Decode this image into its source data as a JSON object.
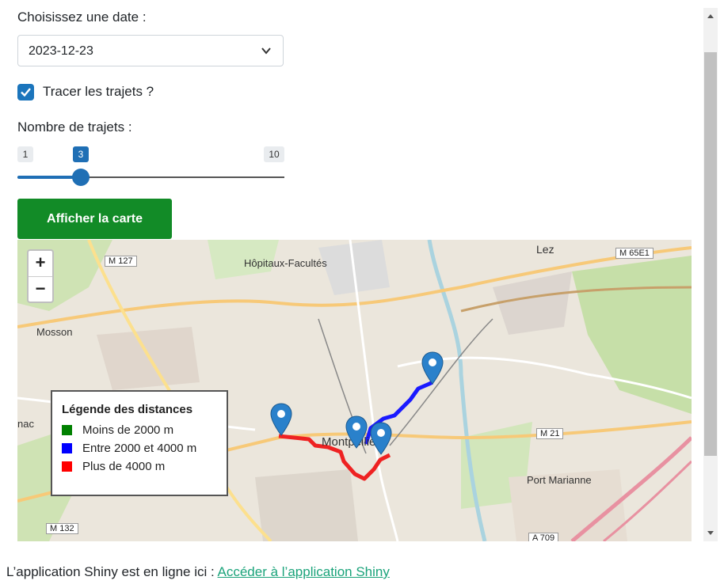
{
  "form": {
    "date_label": "Choisissez une date :",
    "date_value": "2023-12-23",
    "checkbox_label": "Tracer les trajets ?",
    "checkbox_checked": true,
    "slider_label": "Nombre de trajets :",
    "slider_min": "1",
    "slider_max": "10",
    "slider_value": "3",
    "button_label": "Afficher la carte"
  },
  "map": {
    "zoom_in": "+",
    "zoom_out": "−",
    "place_labels": [
      "Hôpitaux-Facultés",
      "Lez",
      "Mosson",
      "Montpellier",
      "Port Marianne",
      "nac"
    ],
    "road_labels": [
      "M 127",
      "M 65E1",
      "M 21",
      "M 132",
      "A 709"
    ],
    "legend": {
      "title": "Légende des distances",
      "items": [
        {
          "label": "Moins de 2000 m",
          "color": "#008000"
        },
        {
          "label": "Entre 2000 et 4000 m",
          "color": "#0000ff"
        },
        {
          "label": "Plus de 4000 m",
          "color": "#ff0000"
        }
      ]
    },
    "route_colors": {
      "blue": "#1a1aff",
      "red": "#ee2222"
    },
    "marker_color": "#2a81cb"
  },
  "footer": {
    "text": "L’application Shiny est en ligne ici : ",
    "link": "Accéder à l’application Shiny"
  }
}
